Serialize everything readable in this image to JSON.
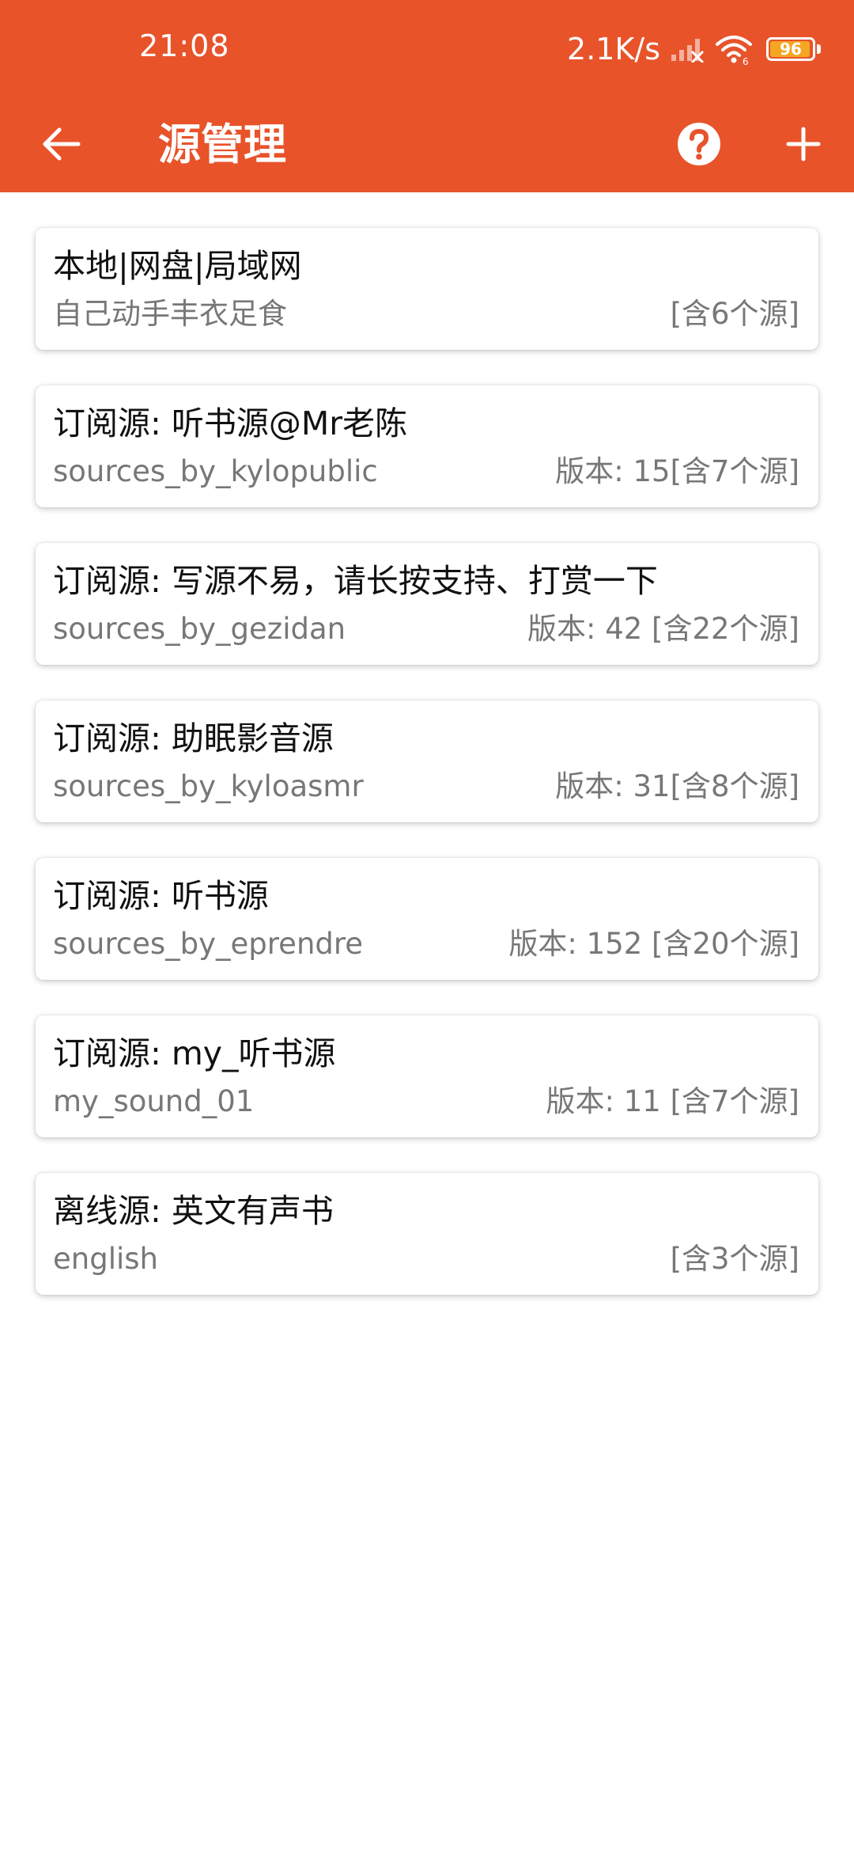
{
  "status_bar": {
    "time": "21:08",
    "net_speed": "2.1K/s",
    "battery_level": "96",
    "battery_fraction": 0.96
  },
  "toolbar": {
    "title": "源管理",
    "back_icon": "arrow-left-icon",
    "help_icon": "help-circle-icon",
    "add_icon": "plus-icon"
  },
  "colors": {
    "header": "#E8532A",
    "battery": "#F5A623",
    "title_text": "#111111",
    "secondary_text": "#777777"
  },
  "sources": [
    {
      "title": "本地|网盘|局域网",
      "subtitle": "自己动手丰衣足食",
      "info": "[含6个源]"
    },
    {
      "title": "订阅源: 听书源@Mr老陈",
      "subtitle": "sources_by_kylopublic",
      "info": "版本: 15[含7个源]"
    },
    {
      "title": "订阅源: 写源不易，请长按支持、打赏一下",
      "subtitle": "sources_by_gezidan",
      "info": "版本: 42  [含22个源]"
    },
    {
      "title": "订阅源: 助眠影音源",
      "subtitle": "sources_by_kyloasmr",
      "info": "版本: 31[含8个源]"
    },
    {
      "title": "订阅源: 听书源",
      "subtitle": "sources_by_eprendre",
      "info": "版本: 152  [含20个源]"
    },
    {
      "title": "订阅源: my_听书源",
      "subtitle": "my_sound_01",
      "info": "版本: 11 [含7个源]"
    },
    {
      "title": "离线源: 英文有声书",
      "subtitle": "english",
      "info": "[含3个源]"
    }
  ]
}
